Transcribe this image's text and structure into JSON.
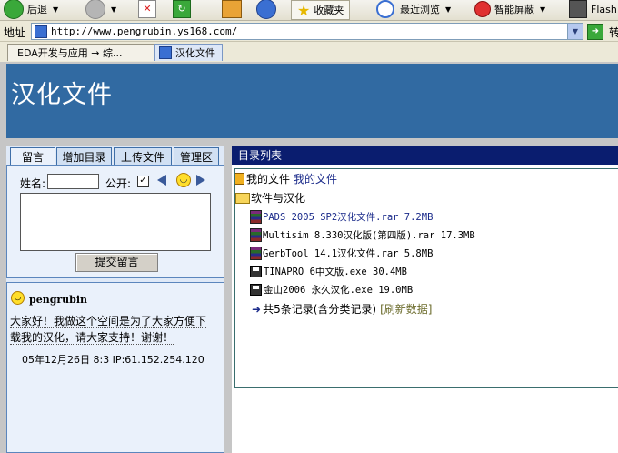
{
  "toolbar": {
    "back_label": "后退",
    "favorites_label": "收藏夹",
    "history_label": "最近浏览",
    "block_label": "智能屏蔽",
    "flash_label": "Flash"
  },
  "address": {
    "label": "地址",
    "url": "http://www.pengrubin.ys168.com/",
    "go_label": "转"
  },
  "browser_tabs": [
    {
      "label": "EDA开发与应用 → 综..."
    },
    {
      "label": "汉化文件"
    }
  ],
  "banner": {
    "title": "汉化文件"
  },
  "panel_tabs": [
    "留言",
    "增加目录",
    "上传文件",
    "管理区"
  ],
  "form": {
    "name_label": "姓名:",
    "public_label": "公开:",
    "checkbox_mark": "✓",
    "submit_label": "提交留言"
  },
  "message": {
    "user": "pengrubin",
    "text_line1": "大家好！我做这个空间是为了大家方便下",
    "text_line2": "载我的汉化，请大家支持！谢谢！",
    "time": "05年12月26日 8:3 IP:61.152.254.120"
  },
  "directory": {
    "header": "目录列表",
    "my_files_name": "我的文件",
    "my_files_link": "我的文件",
    "folder_name": "软件与汉化",
    "files": [
      {
        "name": "PADS 2005 SP2汉化文件.rar 7.2MB",
        "icon": "rar-icon",
        "highlight": true
      },
      {
        "name": "Multisim 8.330汉化版(第四版).rar 17.3MB",
        "icon": "rar-icon",
        "highlight": false
      },
      {
        "name": "GerbTool 14.1汉化文件.rar 5.8MB",
        "icon": "rar-icon",
        "highlight": false
      },
      {
        "name": "TINAPRO 6中文版.exe 30.4MB",
        "icon": "disk-icon",
        "highlight": false
      },
      {
        "name": "金山2006 永久汉化.exe 19.0MB",
        "icon": "disk-icon",
        "highlight": false
      }
    ],
    "summary": "共5条记录(含分类记录)",
    "refresh_label": "[刷新数据]"
  }
}
